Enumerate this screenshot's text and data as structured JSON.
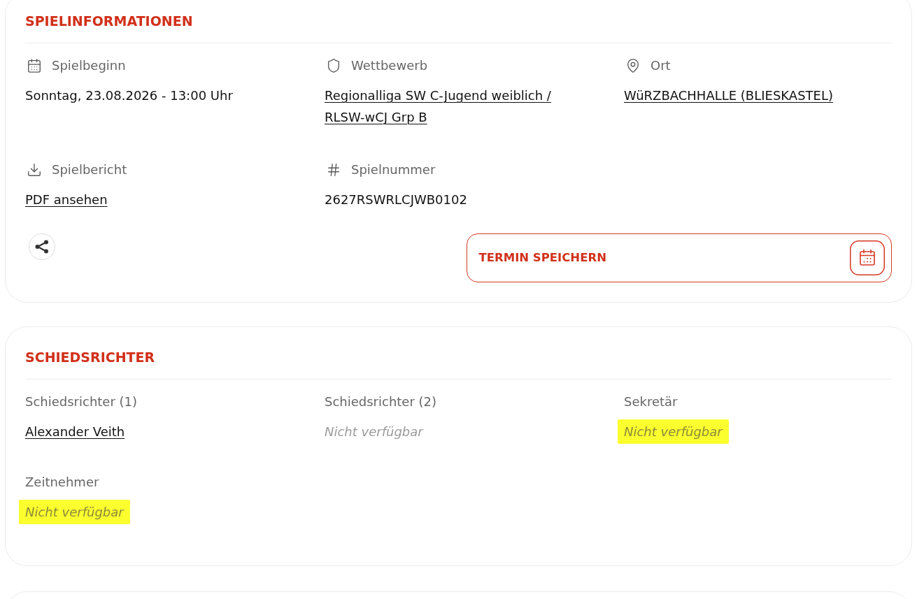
{
  "game_info": {
    "title": "SPIELINFORMATIONEN",
    "fields": [
      {
        "label": "Spielbeginn",
        "value": "Sonntag, 23.08.2026 - 13:00 Uhr",
        "kind": "text"
      },
      {
        "label": "Wettbewerb",
        "value": "Regionalliga SW C-Jugend weiblich / RLSW-wCJ Grp B",
        "kind": "link"
      },
      {
        "label": "Ort",
        "value": "WüRZBACHHALLE (BLIESKASTEL)",
        "kind": "link"
      },
      {
        "label": "Spielbericht",
        "value": "PDF ansehen",
        "kind": "link"
      },
      {
        "label": "Spielnummer",
        "value": "2627RSWRLCJWB0102",
        "kind": "text"
      }
    ],
    "save_button": {
      "label": "TERMIN SPEICHERN"
    }
  },
  "referees": {
    "title": "SCHIEDSRICHTER",
    "fields": [
      {
        "label": "Schiedsrichter (1)",
        "value": "Alexander Veith",
        "kind": "link",
        "highlighted": false
      },
      {
        "label": "Schiedsrichter (2)",
        "value": "Nicht verfügbar",
        "kind": "unavailable",
        "highlighted": false
      },
      {
        "label": "Sekretär",
        "value": "Nicht verfügbar",
        "kind": "unavailable",
        "highlighted": true
      },
      {
        "label": "Zeitnehmer",
        "value": "Nicht verfügbar",
        "kind": "unavailable",
        "highlighted": true
      }
    ]
  }
}
